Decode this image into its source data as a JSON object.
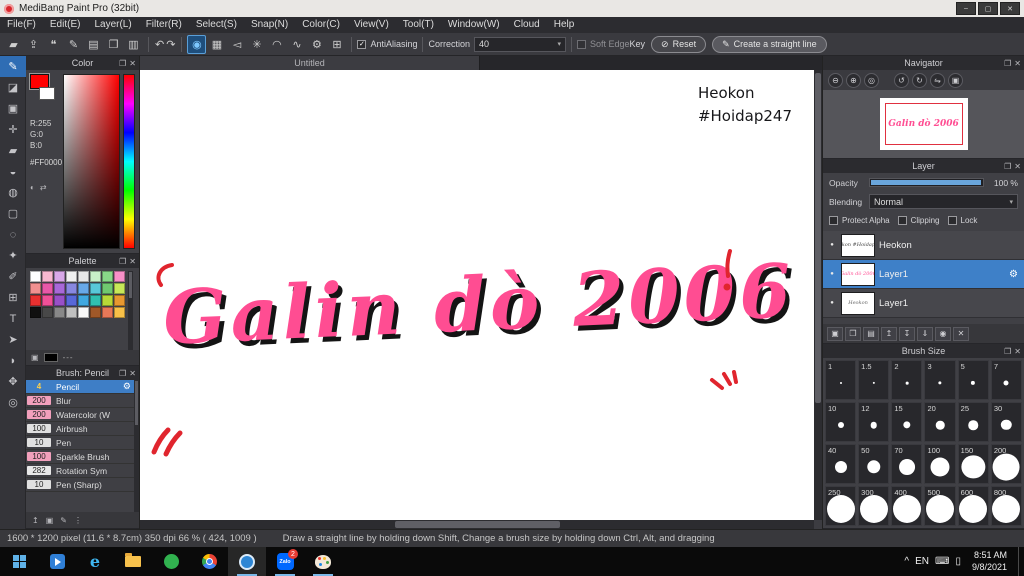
{
  "window": {
    "title": "MediBang Paint Pro (32bit)",
    "minimize_glyph": "–",
    "maximize_glyph": "▢",
    "close_glyph": "✕"
  },
  "glyphs": {
    "popout": "❐",
    "close": "✕",
    "caret": "▾",
    "check": "✓",
    "dot": "●",
    "gear": "⚙"
  },
  "menu": {
    "items": [
      "File(F)",
      "Edit(E)",
      "Layer(L)",
      "Filter(R)",
      "Select(S)",
      "Snap(N)",
      "Color(C)",
      "View(V)",
      "Tool(T)",
      "Window(W)",
      "Cloud",
      "Help"
    ]
  },
  "toolbar": {
    "left_icons": [
      {
        "glyph": "▰",
        "name": "color-chip-icon"
      },
      {
        "glyph": "⇪",
        "name": "export-icon"
      },
      {
        "glyph": "❝",
        "name": "comment-icon"
      },
      {
        "glyph": "✎",
        "name": "edit-icon"
      },
      {
        "glyph": "▤",
        "name": "material-icon"
      },
      {
        "glyph": "❐",
        "name": "pages-icon"
      },
      {
        "glyph": "▥",
        "name": "panel-layout-icon"
      }
    ],
    "undo_glyph": "↶",
    "redo_glyph": "↷",
    "brush_icons": [
      {
        "glyph": "◉",
        "name": "active-brush-icon",
        "selected": true
      },
      {
        "glyph": "▦",
        "name": "brush-panel-icon"
      },
      {
        "glyph": "◅",
        "name": "snap-parallel-icon"
      },
      {
        "glyph": "✳",
        "name": "snap-radial-icon"
      },
      {
        "glyph": "◠",
        "name": "snap-curve-icon"
      },
      {
        "glyph": "∿",
        "name": "snap-spiral-icon"
      },
      {
        "glyph": "⚙",
        "name": "snap-settings-icon"
      },
      {
        "glyph": "⊞",
        "name": "grid-icon"
      }
    ],
    "antialiasing_label": "AntiAliasing",
    "correction_label": "Correction",
    "correction_value": "40",
    "soft_edge_label": "Soft Edge",
    "key_label": "Key",
    "reset_icon": "⊘",
    "reset_label": "Reset",
    "line_icon": "✎",
    "line_label": "Create a straight line"
  },
  "tools": {
    "items": [
      {
        "glyph": "✎",
        "name": "brush-tool",
        "selected": true
      },
      {
        "glyph": "◪",
        "name": "eraser-tool"
      },
      {
        "glyph": "▣",
        "name": "dot-tool"
      },
      {
        "glyph": "✛",
        "name": "move-tool"
      },
      {
        "glyph": "▰",
        "name": "fill-tool"
      },
      {
        "glyph": "◒",
        "name": "bucket-tool"
      },
      {
        "glyph": "◍",
        "name": "gradient-tool"
      },
      {
        "glyph": "▢",
        "name": "select-rect-tool"
      },
      {
        "glyph": "◌",
        "name": "lasso-tool"
      },
      {
        "glyph": "✦",
        "name": "magic-wand-tool"
      },
      {
        "glyph": "✐",
        "name": "select-pen-tool"
      },
      {
        "glyph": "⊞",
        "name": "divide-tool"
      },
      {
        "glyph": "T",
        "name": "text-tool"
      },
      {
        "glyph": "➤",
        "name": "operation-tool"
      },
      {
        "glyph": "◗",
        "name": "eyedropper-tool"
      },
      {
        "glyph": "✥",
        "name": "hand-tool"
      },
      {
        "glyph": "◎",
        "name": "zoom-tool"
      }
    ]
  },
  "color": {
    "title": "Color",
    "r_label": "R:255",
    "g_label": "G:0",
    "b_label": "B:0",
    "hex": "#FF0000",
    "wheel_glyph": "◐",
    "swap_glyph": "⇄"
  },
  "palette": {
    "title": "Palette",
    "add_glyph": "▣",
    "dashes": "---",
    "swatches": [
      "#ffffff",
      "#f8b8d0",
      "#d8a8e8",
      "#f0f0f0",
      "#e8e8e8",
      "#c8f0c8",
      "#88d888",
      "#f890c8",
      "#f09090",
      "#e858a8",
      "#a868d8",
      "#8888e0",
      "#68a8e8",
      "#58c8d8",
      "#70c870",
      "#c8e858",
      "#e83030",
      "#f05098",
      "#9850c8",
      "#5868d8",
      "#40a8e0",
      "#30c0b0",
      "#b8d838",
      "#e89830",
      "#101010",
      "#484848",
      "#888888",
      "#c0c0c0",
      "#f8f8f8",
      "#a05828",
      "#e87858",
      "#f8c048"
    ]
  },
  "brushes": {
    "title": "Brush: Pencil",
    "items": [
      {
        "size": "4",
        "name": "Pencil",
        "selected": true
      },
      {
        "size": "200",
        "name": "Blur",
        "chip": "#f2a0bc"
      },
      {
        "size": "200",
        "name": "Watercolor (W",
        "chip": "#f2a0bc"
      },
      {
        "size": "100",
        "name": "Airbrush",
        "chip": "#e0e0e0"
      },
      {
        "size": "10",
        "name": "Pen",
        "chip": "#e0e0e0"
      },
      {
        "size": "100",
        "name": "Sparkle Brush",
        "chip": "#f2a0bc"
      },
      {
        "size": "282",
        "name": "Rotation Sym",
        "chip": "#e8e8e8"
      },
      {
        "size": "10",
        "name": "Pen (Sharp)",
        "chip": "#e0e0e0"
      }
    ],
    "footer_icons": [
      {
        "glyph": "↥",
        "name": "scroll-up-icon"
      },
      {
        "glyph": "▣",
        "name": "add-brush-icon"
      },
      {
        "glyph": "✎",
        "name": "edit-brush-icon"
      },
      {
        "glyph": "⋮",
        "name": "brush-menu-icon"
      }
    ]
  },
  "canvas": {
    "tab_label": "Untitled",
    "signature_line1": "Heokon",
    "signature_line2": "#Hoidap247",
    "artwork_text": "Galin dò 2006",
    "artwork_color": "#ff4d92",
    "accent_color": "#e0252e"
  },
  "navigator": {
    "title": "Navigator",
    "buttons": [
      {
        "glyph": "⊖",
        "name": "zoom-out-icon"
      },
      {
        "glyph": "⊕",
        "name": "zoom-in-icon"
      },
      {
        "glyph": "◎",
        "name": "zoom-fit-icon"
      },
      {
        "glyph": "↺",
        "name": "rotate-left-icon"
      },
      {
        "glyph": "↻",
        "name": "rotate-right-icon"
      },
      {
        "glyph": "⇋",
        "name": "flip-icon"
      },
      {
        "glyph": "▣",
        "name": "reset-view-icon"
      }
    ]
  },
  "layers": {
    "title": "Layer",
    "opacity_label": "Opacity",
    "opacity_value": "100 %",
    "blending_label": "Blending",
    "blending_value": "Normal",
    "protect_alpha_label": "Protect Alpha",
    "clipping_label": "Clipping",
    "lock_label": "Lock",
    "items": [
      {
        "name": "Heokon",
        "thumb_text": "Heokon #Hoidap247",
        "thumb_color": "#444444"
      },
      {
        "name": "Layer1",
        "thumb_text": "Galin dò 2006",
        "thumb_color": "#ff4d92",
        "selected": true
      },
      {
        "name": "Layer1",
        "thumb_text": "Heokon",
        "thumb_color": "#666666"
      }
    ],
    "footer_icons": [
      {
        "glyph": "▣",
        "name": "new-layer-icon"
      },
      {
        "glyph": "❐",
        "name": "duplicate-layer-icon"
      },
      {
        "glyph": "▤",
        "name": "new-folder-icon"
      },
      {
        "glyph": "↥",
        "name": "layer-up-icon"
      },
      {
        "glyph": "↧",
        "name": "layer-down-icon"
      },
      {
        "glyph": "⇓",
        "name": "merge-layer-icon"
      },
      {
        "glyph": "◉",
        "name": "snapshot-icon"
      },
      {
        "glyph": "✕",
        "name": "delete-layer-icon"
      }
    ]
  },
  "brush_sizes": {
    "title": "Brush Size",
    "values": [
      "1",
      "1.5",
      "2",
      "3",
      "5",
      "7",
      "10",
      "12",
      "15",
      "20",
      "25",
      "30",
      "40",
      "50",
      "70",
      "100",
      "150",
      "200",
      "250",
      "300",
      "400",
      "500",
      "600",
      "800"
    ]
  },
  "status": {
    "info": "1600 * 1200 pixel   (11.6 * 8.7cm)   350 dpi   66 %   ( 424, 1009 )",
    "hint": "Draw a straight line by holding down Shift, Change a brush size by holding down Ctrl, Alt, and dragging"
  },
  "taskbar": {
    "language": "EN",
    "tray_expand": "^",
    "keyboard_glyph": "⌨",
    "battery_glyph": "▯",
    "edge_letter": "e",
    "zalo_label": "Zalo",
    "zalo_badge": "2",
    "time": "8:51 AM",
    "date": "9/8/2021"
  }
}
